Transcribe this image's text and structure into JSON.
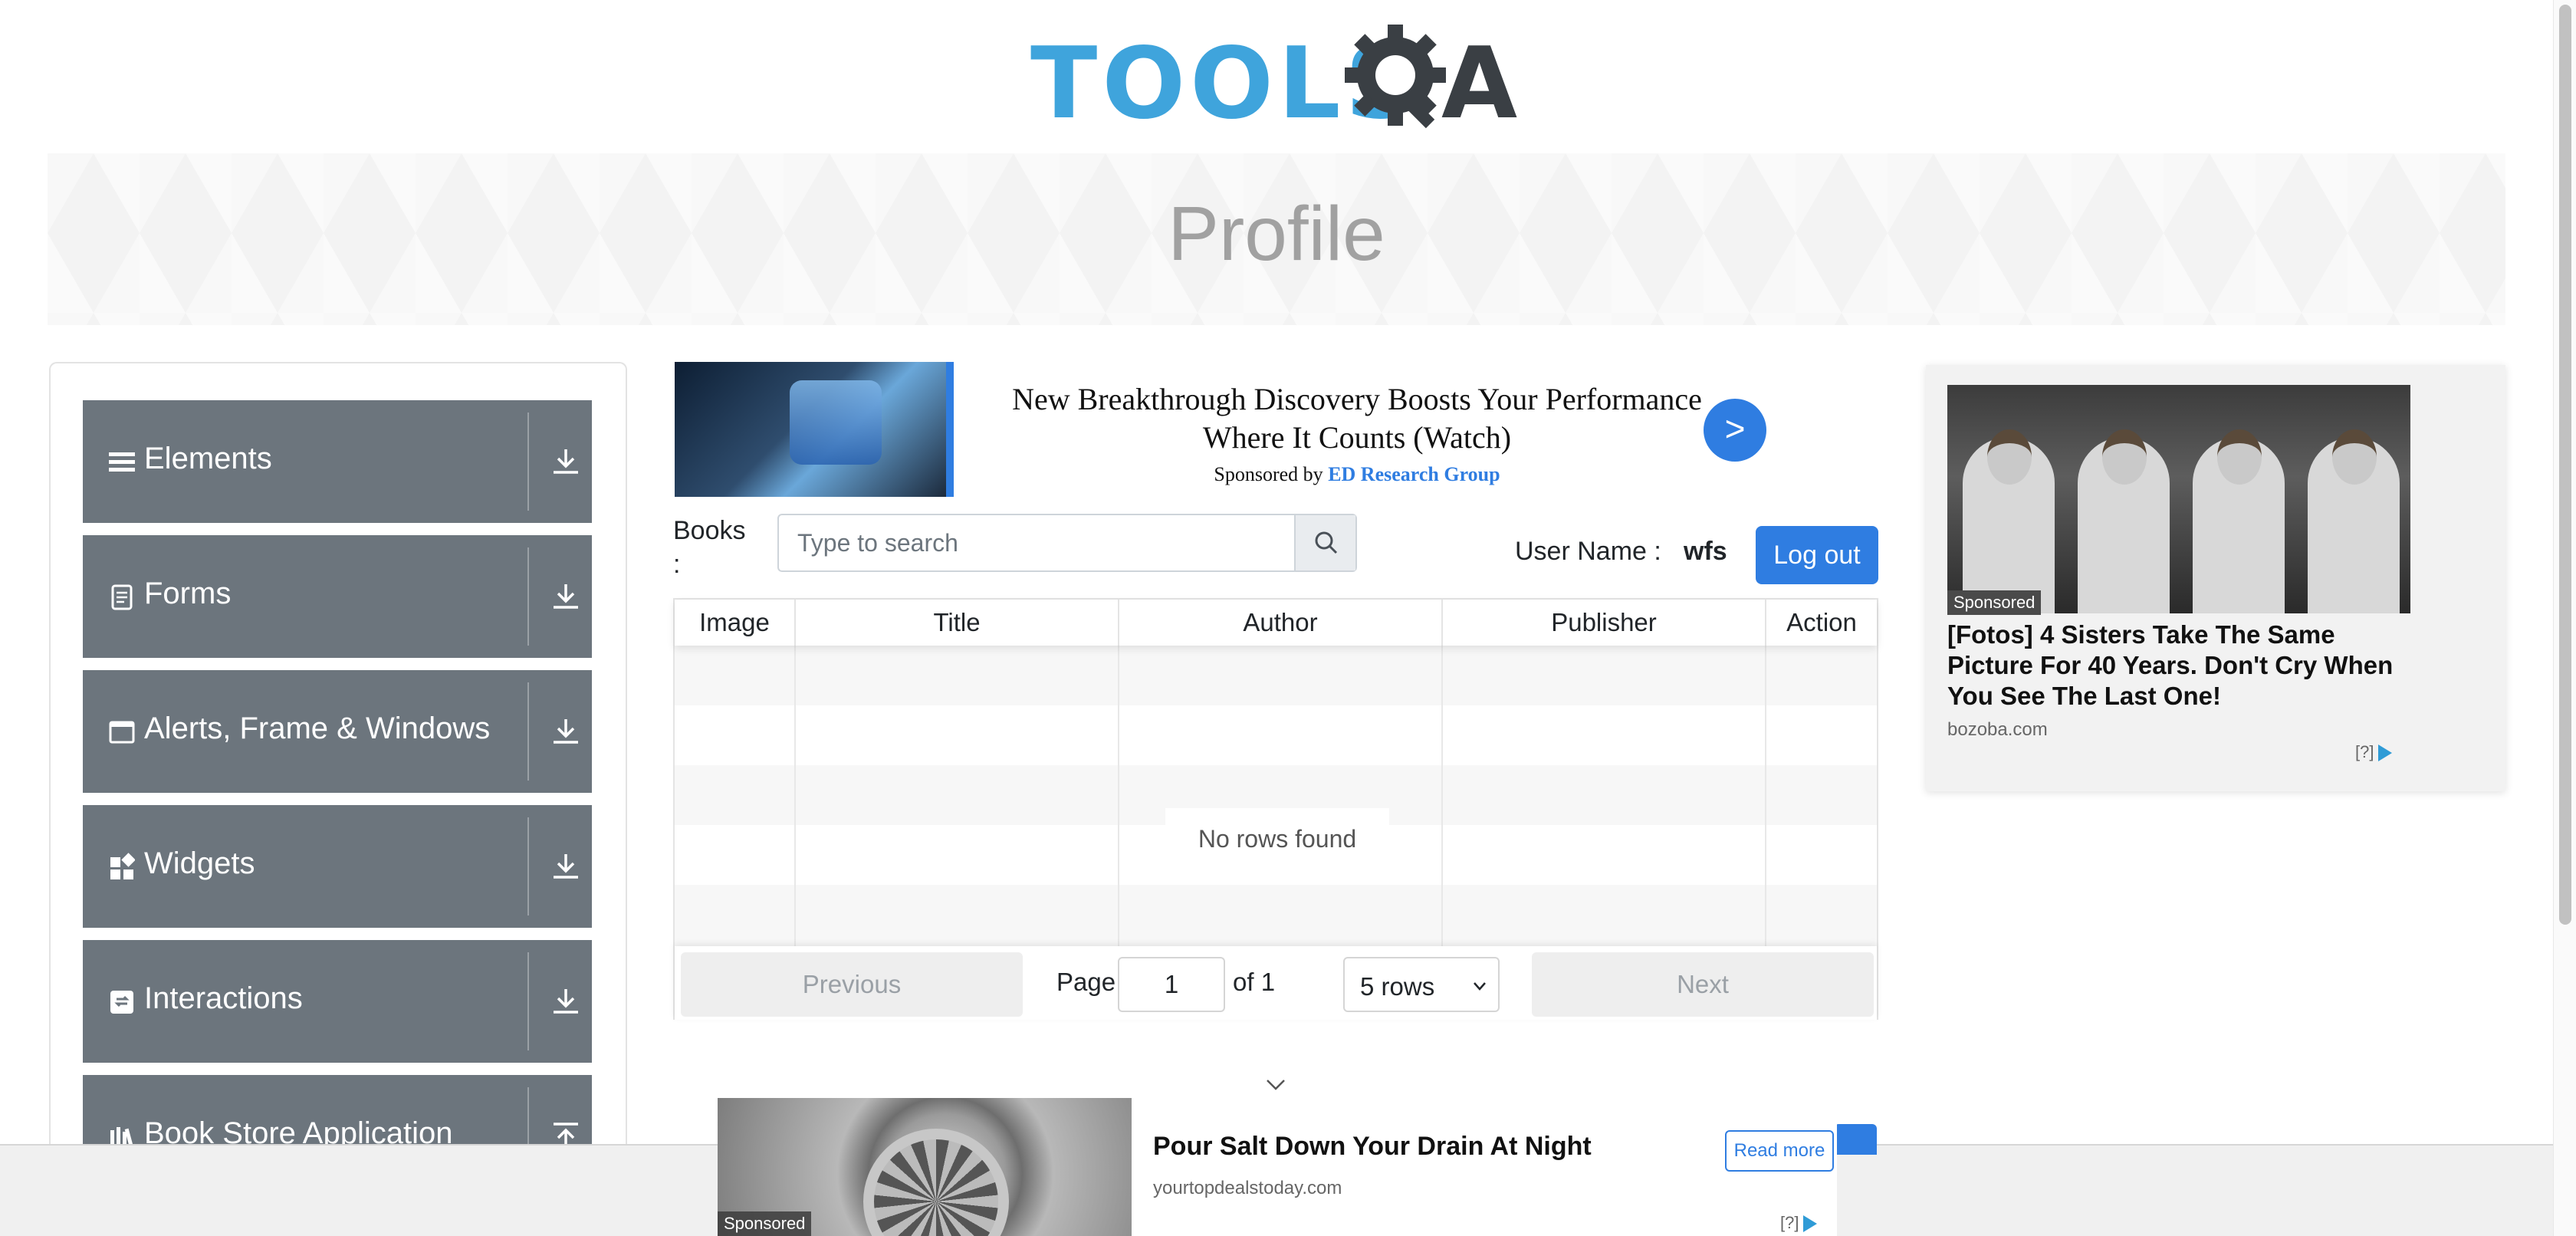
{
  "header": {
    "logo_text": "TOOLS",
    "logo_suffix": "A",
    "page_title": "Profile"
  },
  "sidebar": {
    "groups": [
      {
        "label": "Elements",
        "icon": "hamburger-icon"
      },
      {
        "label": "Forms",
        "icon": "document-icon"
      },
      {
        "label": "Alerts, Frame & Windows",
        "icon": "window-icon"
      },
      {
        "label": "Widgets",
        "icon": "widgets-icon"
      },
      {
        "label": "Interactions",
        "icon": "interactions-icon"
      },
      {
        "label": "Book Store Application",
        "icon": "books-icon"
      }
    ]
  },
  "ad_top": {
    "headline": "New Breakthrough Discovery Boosts Your Performance Where It Counts (Watch)",
    "sponsored_prefix": "Sponsored by",
    "sponsor": "ED Research Group",
    "go_label": ">"
  },
  "books": {
    "label": "Books :",
    "search_placeholder": "Type to search"
  },
  "user": {
    "label": "User Name :",
    "value": "wfs",
    "logout_label": "Log out"
  },
  "table": {
    "columns": [
      "Image",
      "Title",
      "Author",
      "Publisher",
      "Action"
    ],
    "empty_text": "No rows found"
  },
  "pagination": {
    "previous": "Previous",
    "page_label": "Page",
    "page_value": "1",
    "of_label": "of 1",
    "rows_value": "5 rows",
    "next": "Next"
  },
  "ad_right": {
    "badge": "Sponsored",
    "title": "[Fotos] 4 Sisters Take The Same Picture For 40 Years. Don't Cry When You See The Last One!",
    "domain": "bozoba.com",
    "adchoice": "[?]"
  },
  "ad_bottom": {
    "badge": "Sponsored",
    "title": "Pour Salt Down Your Drain At Night",
    "domain": "yourtopdealstoday.com",
    "cta": "Read more",
    "adchoice": "[?]"
  },
  "colors": {
    "accent": "#2f7de1",
    "sidebar": "#6c757d",
    "logo_blue": "#3fa4dc"
  }
}
